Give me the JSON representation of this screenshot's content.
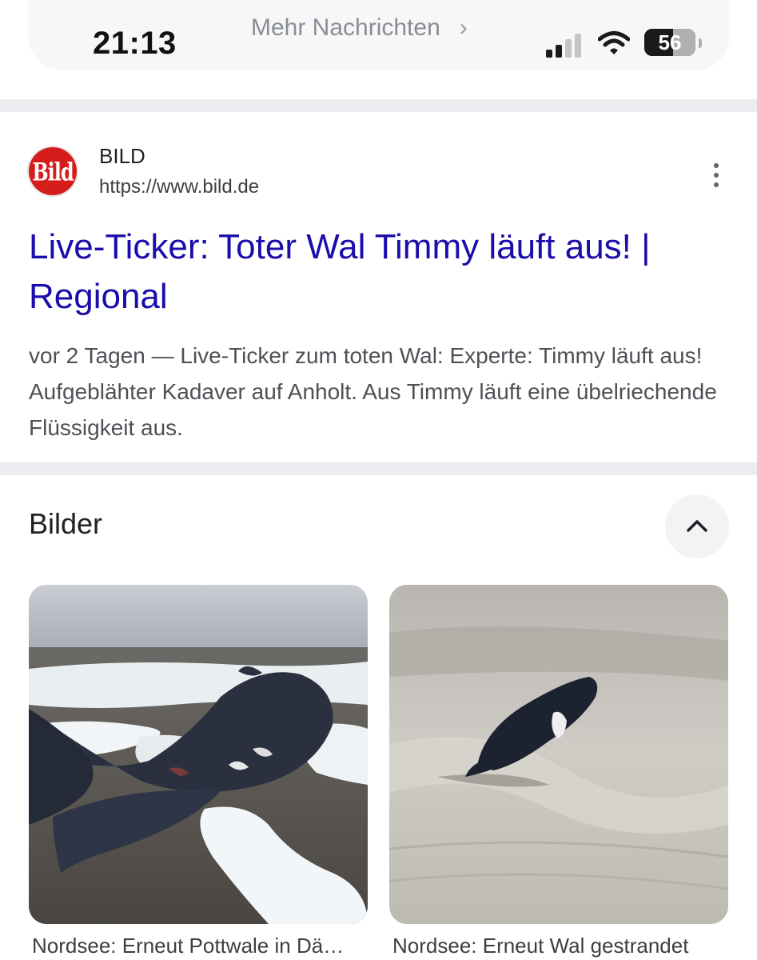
{
  "status_bar": {
    "time": "21:13",
    "banner_label": "Mehr Nachrichten",
    "banner_chevron": "›",
    "battery_level": "56",
    "signal_icon": "cellular-signal-icon",
    "wifi_icon": "wifi-icon"
  },
  "result": {
    "site_name": "BILD",
    "site_url": "https://www.bild.de",
    "logo_text": "Bild",
    "title": "Live-Ticker: Toter Wal Timmy läuft aus! | Regional",
    "snippet": "vor 2 Tagen — Live-Ticker zum toten Wal: Experte: Timmy läuft aus! Aufgeblähter Kadaver auf Anholt. Aus Timmy läuft eine übelriechende Flüssigkeit aus.",
    "title_color": "#1a0dab",
    "logo_color": "#d71c1c"
  },
  "images": {
    "heading": "Bilder",
    "collapse_icon": "chevron-up-icon",
    "items": [
      {
        "caption": "Nordsee: Erneut Pottwale in Dä…"
      },
      {
        "caption": "Nordsee: Erneut Wal gestrandet"
      }
    ]
  }
}
